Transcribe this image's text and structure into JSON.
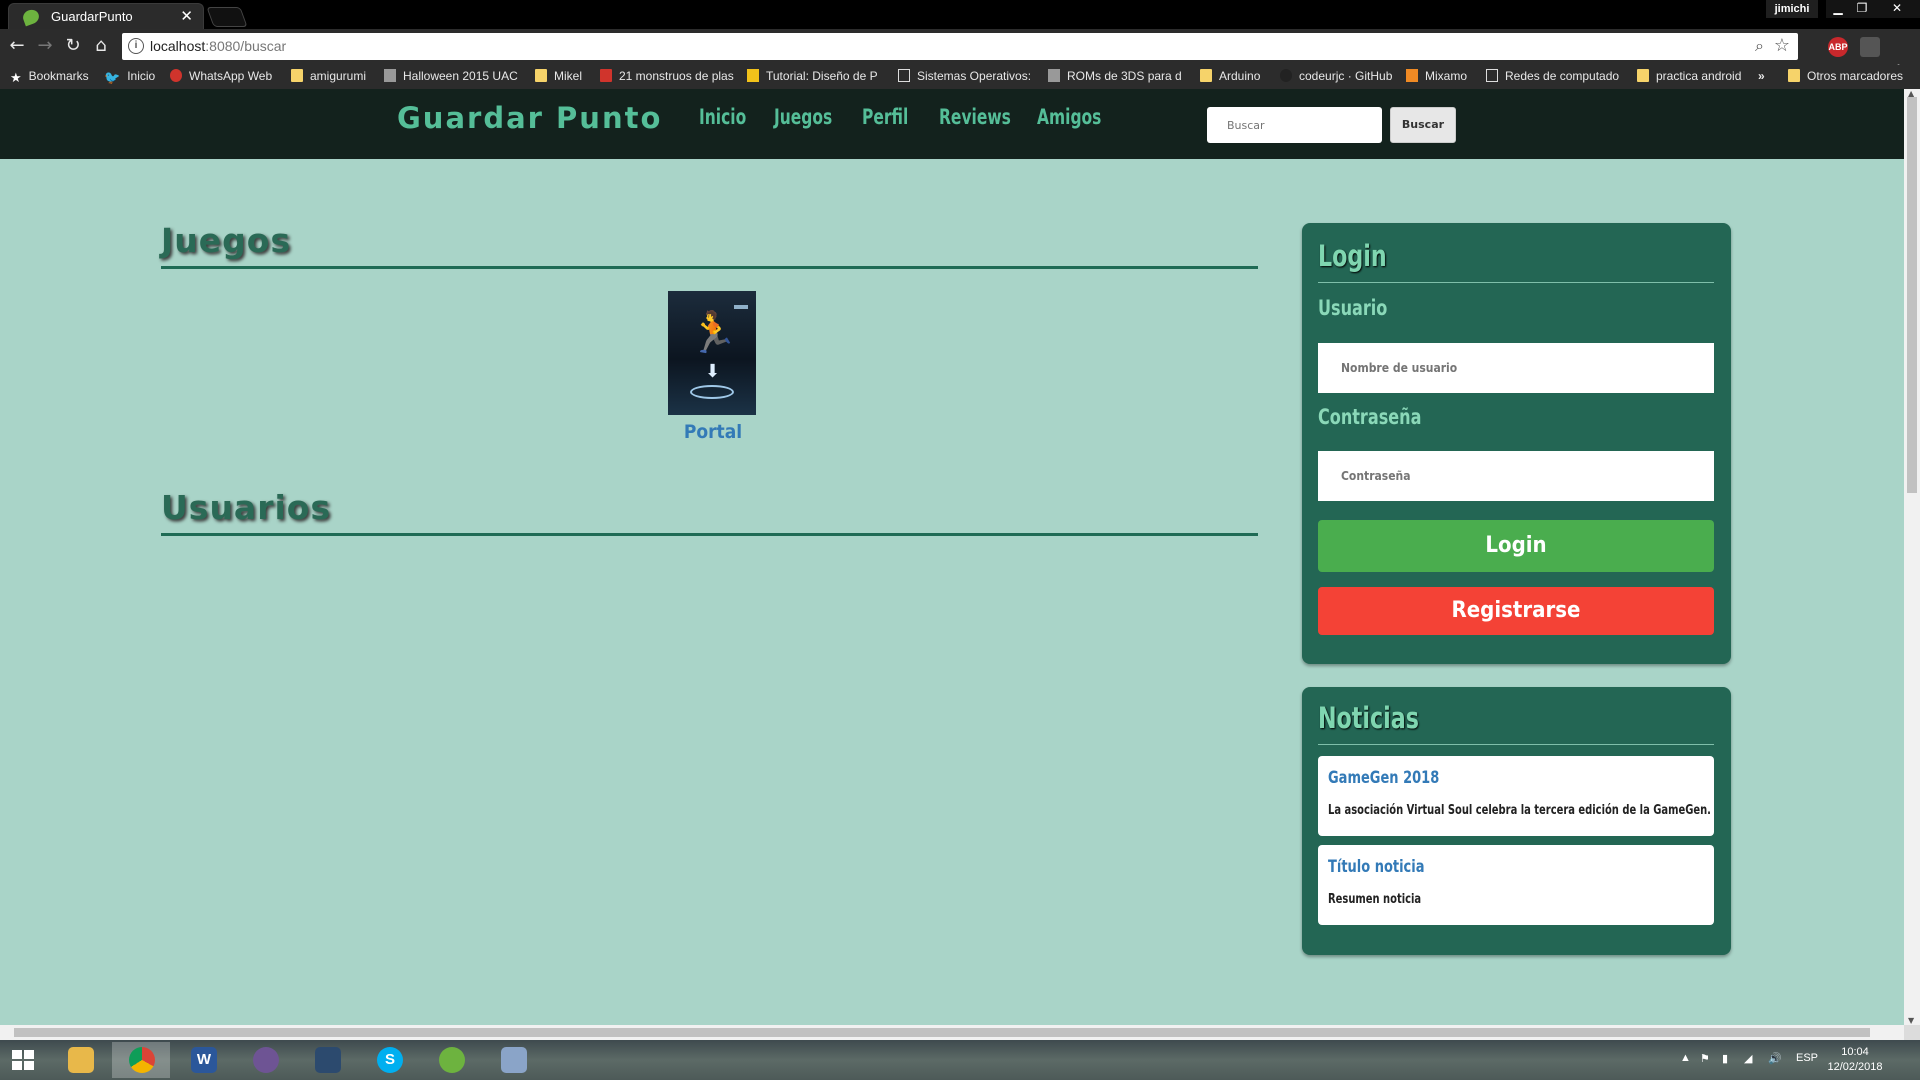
{
  "browser": {
    "tab_title": "GuardarPunto",
    "tab_close": "✕",
    "profile_name": "jimichi",
    "url_host": "localhost",
    "url_path": ":8080/buscar",
    "extensions": {
      "abp": "ABP"
    }
  },
  "bookmarks": [
    {
      "label": "Bookmarks",
      "icon": "star-icon"
    },
    {
      "label": "Inicio",
      "icon": "twitter-icon"
    },
    {
      "label": "WhatsApp Web",
      "icon": "whatsapp-icon"
    },
    {
      "label": "amigurumi",
      "icon": "folder-icon"
    },
    {
      "label": "Halloween 2015 UAC",
      "icon": "image-icon"
    },
    {
      "label": "Mikel",
      "icon": "folder-icon"
    },
    {
      "label": "21 monstruos de plas",
      "icon": "red-site-icon"
    },
    {
      "label": "Tutorial: Diseño de P",
      "icon": "nfd-icon"
    },
    {
      "label": "Sistemas Operativos:",
      "icon": "site-icon"
    },
    {
      "label": "ROMs de 3DS para d",
      "icon": "site-icon"
    },
    {
      "label": "Arduino",
      "icon": "folder-icon"
    },
    {
      "label": "codeurjc · GitHub",
      "icon": "github-icon"
    },
    {
      "label": "Mixamo",
      "icon": "mixamo-icon"
    },
    {
      "label": "Redes de computado",
      "icon": "page-icon"
    },
    {
      "label": "practica android",
      "icon": "folder-icon"
    },
    {
      "label": "Otros marcadores",
      "icon": "folder-icon"
    }
  ],
  "bookmarks_overflow": "»",
  "site": {
    "brand": "Guardar Punto",
    "nav": [
      "Inicio",
      "Juegos",
      "Perfil",
      "Reviews",
      "Amigos"
    ],
    "search_placeholder": "Buscar",
    "search_button": "Buscar"
  },
  "results": {
    "games_heading": "Juegos",
    "games": [
      {
        "title": "Portal"
      }
    ],
    "users_heading": "Usuarios"
  },
  "login": {
    "title": "Login",
    "user_label": "Usuario",
    "user_placeholder": "Nombre de usuario",
    "password_label": "Contraseña",
    "password_placeholder": "Contraseña",
    "login_button": "Login",
    "register_button": "Registrarse"
  },
  "news": {
    "title": "Noticias",
    "items": [
      {
        "title": "GameGen 2018",
        "summary": "La asociación Virtual Soul celebra la tercera edición de la GameGen."
      },
      {
        "title": "Título noticia",
        "summary": "Resumen noticia"
      }
    ]
  },
  "taskbar": {
    "apps": [
      {
        "name": "file-explorer",
        "glyph": "",
        "color": "#e8b84a"
      },
      {
        "name": "chrome",
        "glyph": "",
        "color": "#db4437"
      },
      {
        "name": "word",
        "glyph": "W",
        "color": "#2b579a"
      },
      {
        "name": "github-desktop",
        "glyph": "",
        "color": "#6e5494"
      },
      {
        "name": "mysql-workbench",
        "glyph": "",
        "color": "#2c4a6e"
      },
      {
        "name": "skype",
        "glyph": "S",
        "color": "#00aff0"
      },
      {
        "name": "spring-tool-suite",
        "glyph": "",
        "color": "#6db33f"
      },
      {
        "name": "paint",
        "glyph": "",
        "color": "#8aa4c8"
      }
    ],
    "language": "ESP",
    "time": "10:04",
    "date": "12/02/2018"
  },
  "colors": {
    "header_bg": "#13221d",
    "brand_green": "#55be98",
    "page_bg": "#a9d4c8",
    "panel_bg": "#236654",
    "link_blue": "#337ab7",
    "login_green": "#4aad4e",
    "register_red": "#f44236"
  }
}
